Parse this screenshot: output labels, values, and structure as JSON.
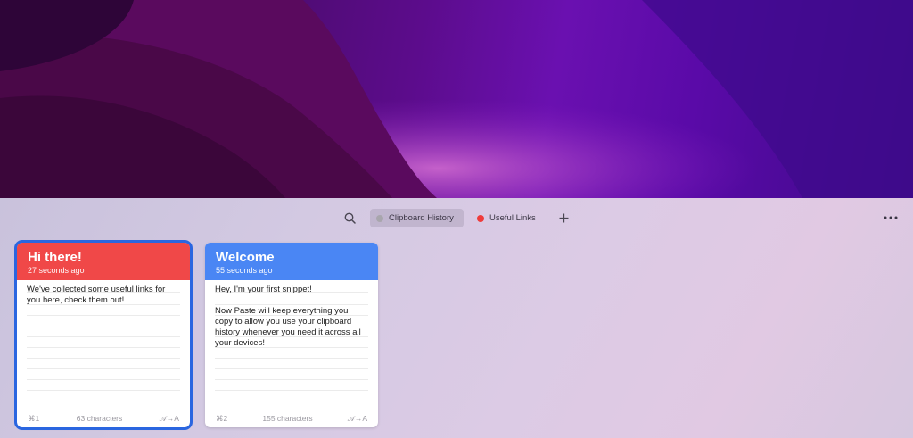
{
  "toolbar": {
    "search_icon": "search-icon",
    "pinboards": [
      {
        "label": "Clipboard History",
        "color": "#a8a6ad",
        "active": true
      },
      {
        "label": "Useful Links",
        "color": "#ef3b3b",
        "active": false
      }
    ],
    "add_icon": "plus-icon",
    "more_icon": "ellipsis-icon"
  },
  "cards": [
    {
      "title": "Hi there!",
      "time": "27 seconds ago",
      "color": "#f04848",
      "text": "We've collected some useful links for you here, check them out!",
      "shortcut": "⌘1",
      "chars": "63 characters",
      "type_icon": "A⃗→A"
    },
    {
      "title": "Welcome",
      "time": "55 seconds ago",
      "color": "#4a86f4",
      "text": "Hey, I'm your first snippet!\n\nNow Paste will keep everything you copy to allow you use your clipboard history whenever you need it across all your devices!",
      "shortcut": "⌘2",
      "chars": "155 characters",
      "type_icon": "A⃗→A"
    }
  ]
}
